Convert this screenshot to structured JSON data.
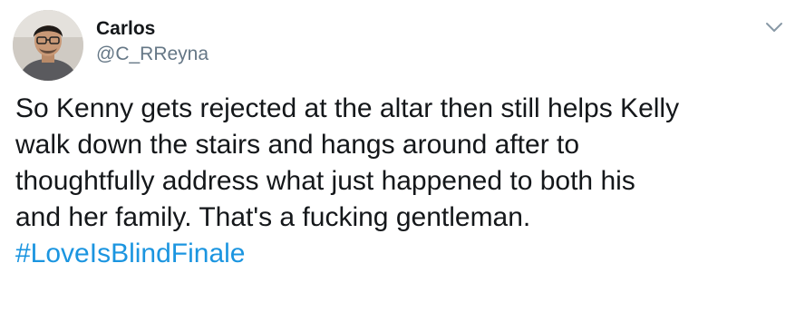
{
  "tweet": {
    "author_name": "Carlos",
    "author_handle": "@C_RReyna",
    "text_lines": [
      "So Kenny gets rejected at the altar then still helps Kelly",
      "walk down the stairs and hangs around after to",
      "thoughtfully address what just happened to both his",
      "and her family. That's a fucking gentleman."
    ],
    "hashtag": "#LoveIsBlindFinale",
    "menu_icon": "chevron-down-icon",
    "colors": {
      "text": "#14171a",
      "secondary_text": "#657786",
      "link": "#1b95e0",
      "icon": "#8899a6"
    }
  }
}
